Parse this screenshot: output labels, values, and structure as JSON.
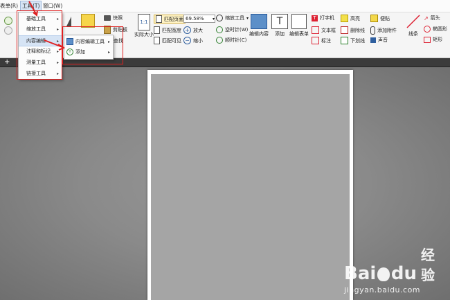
{
  "menubar": {
    "items": [
      {
        "label": "表单(R)"
      },
      {
        "label": "工具(T)"
      },
      {
        "label": "窗口(W)"
      }
    ]
  },
  "tools_menu": {
    "items": [
      {
        "label": "基础工具"
      },
      {
        "label": "缩放工具"
      },
      {
        "label": "内容编辑"
      },
      {
        "label": "注释和标记"
      },
      {
        "label": "测量工具"
      },
      {
        "label": "链接工具"
      }
    ]
  },
  "submenu": {
    "items": [
      {
        "label": "内容编辑工具"
      },
      {
        "label": "添加"
      }
    ]
  },
  "ribbon": {
    "snapshot": "快照",
    "clipboard": "剪贴板",
    "find": "查找",
    "actual_size": "实际大小",
    "fit_page": "匹配页面",
    "fit_width": "匹配宽度",
    "fit_visible": "匹配可见",
    "zoom_value": "69.58%",
    "zoom_tools": "缩放工具",
    "zoom_in": "放大",
    "zoom_out": "缩小",
    "rotate_left": "逆时针(W)",
    "rotate_right": "顺时针(C)",
    "edit_content": "编辑内容",
    "add": "添加",
    "edit_form": "编辑表单",
    "typewriter": "打字机",
    "textbox": "文本框",
    "callout": "标注",
    "highlight": "高亮",
    "strikeout": "删除线",
    "underline": "下划线",
    "note": "便贴",
    "attach": "添加附件",
    "sound": "声音",
    "line": "线条",
    "arrow": "箭头",
    "ellipse": "椭圆形",
    "rectangle": "矩形"
  },
  "watermark": {
    "brand": "Bai",
    "paw": "du",
    "jingyan": "经验",
    "url": "jingyan.baidu.com"
  },
  "colors": {
    "accent": "#d6e4f5",
    "red": "#e02020",
    "canvas": "#8a8a8a"
  }
}
